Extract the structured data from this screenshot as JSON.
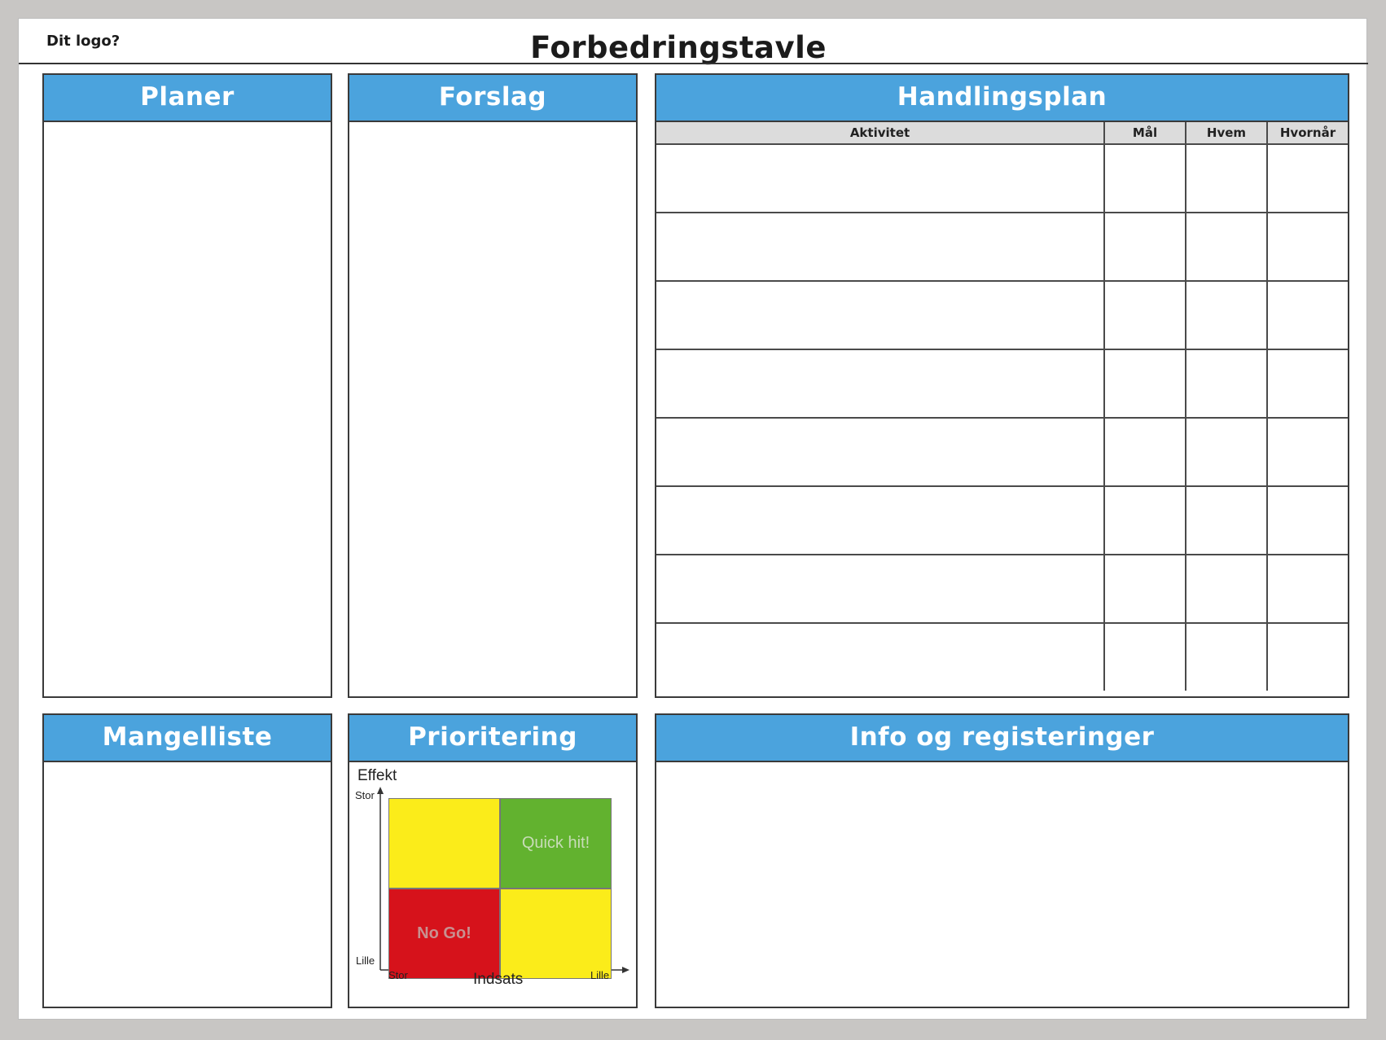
{
  "header": {
    "logo_text": "Dit logo?",
    "title": "Forbedringstavle"
  },
  "panels": {
    "planer": {
      "title": "Planer"
    },
    "forslag": {
      "title": "Forslag"
    },
    "handlingsplan": {
      "title": "Handlingsplan",
      "columns": [
        "Aktivitet",
        "Mål",
        "Hvem",
        "Hvornår"
      ],
      "row_count": 8
    },
    "mangelliste": {
      "title": "Mangelliste"
    },
    "prioritering": {
      "title": "Prioritering",
      "y_axis": {
        "label": "Effekt",
        "high": "Stor",
        "low": "Lille"
      },
      "x_axis": {
        "label": "Indsats",
        "left": "Stor",
        "right": "Lille"
      },
      "quadrants": {
        "top_left": {
          "text": "",
          "color": "#fbec1a"
        },
        "top_right": {
          "text": "Quick hit!",
          "color": "#62b22f"
        },
        "bottom_left": {
          "text": "No Go!",
          "color": "#d6121b"
        },
        "bottom_right": {
          "text": "",
          "color": "#fbec1a"
        }
      }
    },
    "info": {
      "title": "Info og registeringer"
    }
  },
  "colors": {
    "header_blue": "#4ba3dd",
    "table_header_gray": "#dcdcdc"
  }
}
